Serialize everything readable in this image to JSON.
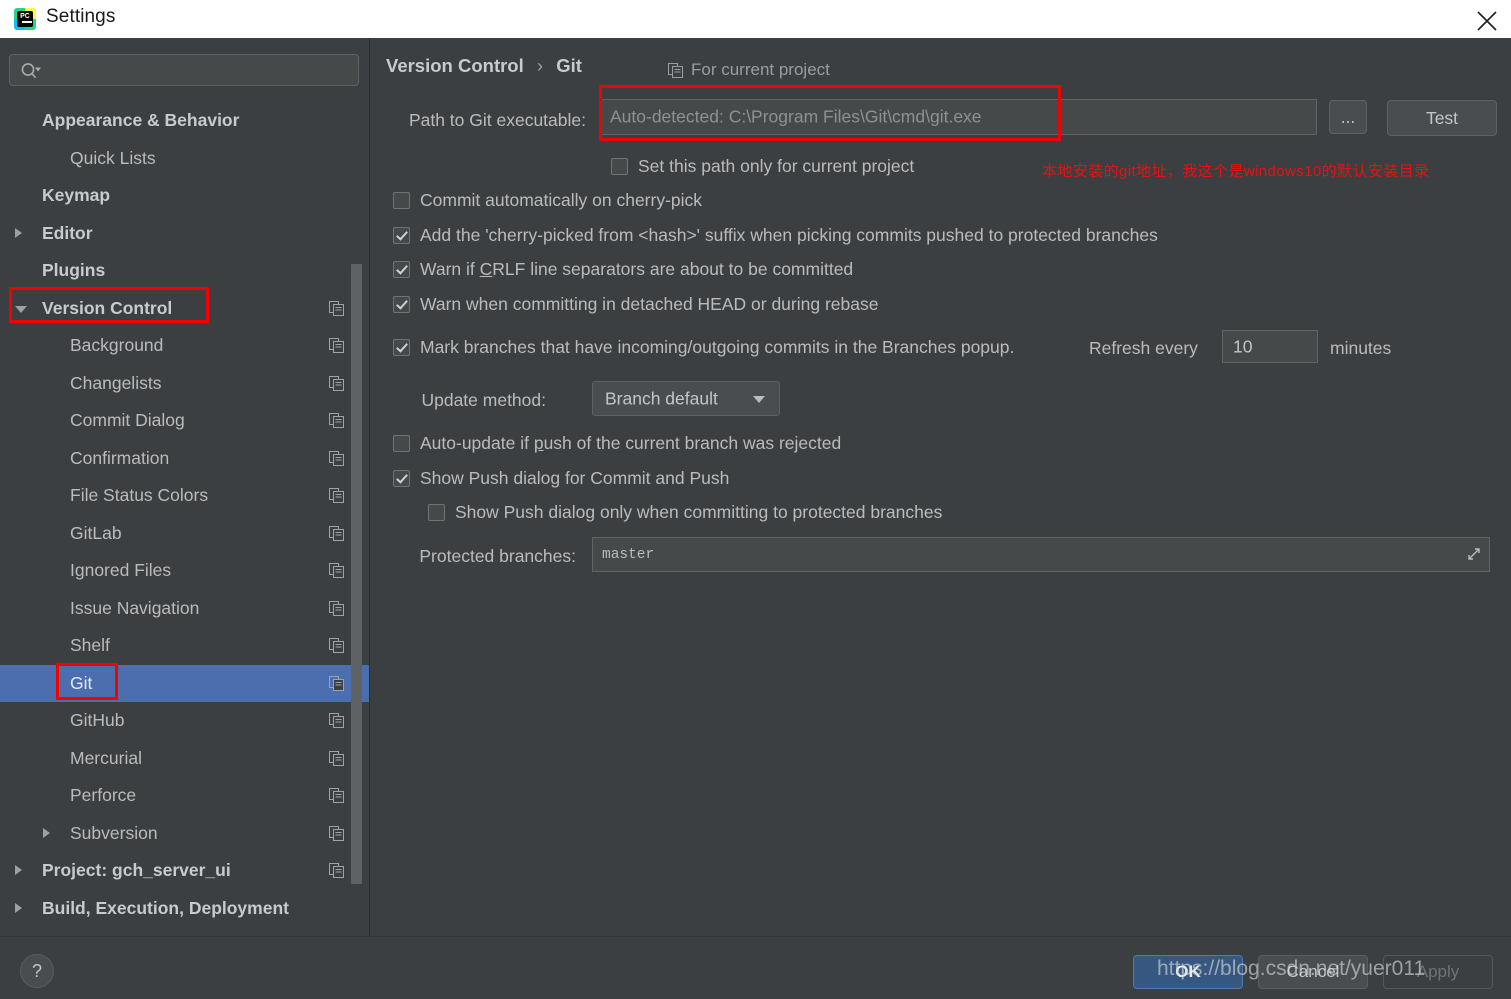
{
  "window": {
    "title": "Settings",
    "app_icon": "pycharm-icon",
    "close_icon": "close-icon"
  },
  "sidebar": {
    "search": {
      "placeholder": "",
      "icon": "search-icon"
    },
    "items": [
      {
        "label": "Appearance & Behavior",
        "indent": 42,
        "bold": true,
        "arrow": "none",
        "copy": false,
        "selected": false
      },
      {
        "label": "Quick Lists",
        "indent": 70,
        "bold": false,
        "arrow": "none",
        "copy": false,
        "selected": false
      },
      {
        "label": "Keymap",
        "indent": 42,
        "bold": true,
        "arrow": "none",
        "copy": false,
        "selected": false
      },
      {
        "label": "Editor",
        "indent": 42,
        "bold": true,
        "arrow": "right",
        "copy": false,
        "selected": false
      },
      {
        "label": "Plugins",
        "indent": 42,
        "bold": true,
        "arrow": "none",
        "copy": false,
        "selected": false
      },
      {
        "label": "Version Control",
        "indent": 42,
        "bold": true,
        "arrow": "down",
        "copy": true,
        "selected": false
      },
      {
        "label": "Background",
        "indent": 70,
        "bold": false,
        "arrow": "none",
        "copy": true,
        "selected": false
      },
      {
        "label": "Changelists",
        "indent": 70,
        "bold": false,
        "arrow": "none",
        "copy": true,
        "selected": false
      },
      {
        "label": "Commit Dialog",
        "indent": 70,
        "bold": false,
        "arrow": "none",
        "copy": true,
        "selected": false
      },
      {
        "label": "Confirmation",
        "indent": 70,
        "bold": false,
        "arrow": "none",
        "copy": true,
        "selected": false
      },
      {
        "label": "File Status Colors",
        "indent": 70,
        "bold": false,
        "arrow": "none",
        "copy": true,
        "selected": false
      },
      {
        "label": "GitLab",
        "indent": 70,
        "bold": false,
        "arrow": "none",
        "copy": true,
        "selected": false
      },
      {
        "label": "Ignored Files",
        "indent": 70,
        "bold": false,
        "arrow": "none",
        "copy": true,
        "selected": false
      },
      {
        "label": "Issue Navigation",
        "indent": 70,
        "bold": false,
        "arrow": "none",
        "copy": true,
        "selected": false
      },
      {
        "label": "Shelf",
        "indent": 70,
        "bold": false,
        "arrow": "none",
        "copy": true,
        "selected": false
      },
      {
        "label": "Git",
        "indent": 70,
        "bold": false,
        "arrow": "none",
        "copy": true,
        "selected": true
      },
      {
        "label": "GitHub",
        "indent": 70,
        "bold": false,
        "arrow": "none",
        "copy": true,
        "selected": false
      },
      {
        "label": "Mercurial",
        "indent": 70,
        "bold": false,
        "arrow": "none",
        "copy": true,
        "selected": false
      },
      {
        "label": "Perforce",
        "indent": 70,
        "bold": false,
        "arrow": "none",
        "copy": true,
        "selected": false
      },
      {
        "label": "Subversion",
        "indent": 70,
        "bold": false,
        "arrow": "right",
        "copy": true,
        "selected": false
      },
      {
        "label": "Project: gch_server_ui",
        "indent": 42,
        "bold": true,
        "arrow": "right",
        "copy": true,
        "selected": false
      },
      {
        "label": "Build, Execution, Deployment",
        "indent": 42,
        "bold": true,
        "arrow": "right",
        "copy": false,
        "selected": false
      }
    ]
  },
  "main": {
    "breadcrumb": {
      "root": "Version Control",
      "separator": "›",
      "leaf": "Git"
    },
    "for_current_project": {
      "label": "For current project",
      "icon": "copy-icon"
    },
    "path_label": "Path to Git executable:",
    "path_value": "",
    "path_placeholder": "Auto-detected: C:\\Program Files\\Git\\cmd\\git.exe",
    "browse_button": "...",
    "test_button": "Test",
    "checkboxes": [
      {
        "label": "Set this path only for current project",
        "checked": false
      },
      {
        "label": "Commit automatically on cherry-pick",
        "checked": false
      },
      {
        "label": "Add the 'cherry-picked from <hash>' suffix when picking commits pushed to protected branches",
        "checked": true
      },
      {
        "label": "Warn if CRLF line separators are about to be committed",
        "checked": true
      },
      {
        "label": "Warn when committing in detached HEAD or during rebase",
        "checked": true
      }
    ],
    "mark_branches": {
      "label": "Mark branches that have incoming/outgoing commits in the Branches popup.",
      "checked": true,
      "refresh_label": "Refresh every",
      "refresh_value": "10",
      "minutes_label": "minutes"
    },
    "update_method": {
      "label": "Update method:",
      "value": "Branch default"
    },
    "auto_update": {
      "label": "Auto-update if push of the current branch was rejected",
      "checked": false
    },
    "show_push": {
      "label": "Show Push dialog for Commit and Push",
      "checked": true
    },
    "show_push_protected": {
      "label": "Show Push dialog only when committing to protected branches",
      "checked": false
    },
    "protected_branches": {
      "label": "Protected branches:",
      "value": "master",
      "expand_icon": "expand-icon"
    },
    "annotation": "本地安装的git地址，我这个是windows10的默认安装目录"
  },
  "footer": {
    "help_label": "?",
    "ok_label": "OK",
    "cancel_label": "Cancel",
    "apply_label": "Apply",
    "watermark": "https://blog.csdn.net/yuer011"
  },
  "colors": {
    "background": "#3c3f41",
    "selection": "#4b6eaf",
    "accent_ok": "#365880",
    "annotation_red": "#e81111",
    "highlight_box": "#f40000"
  }
}
